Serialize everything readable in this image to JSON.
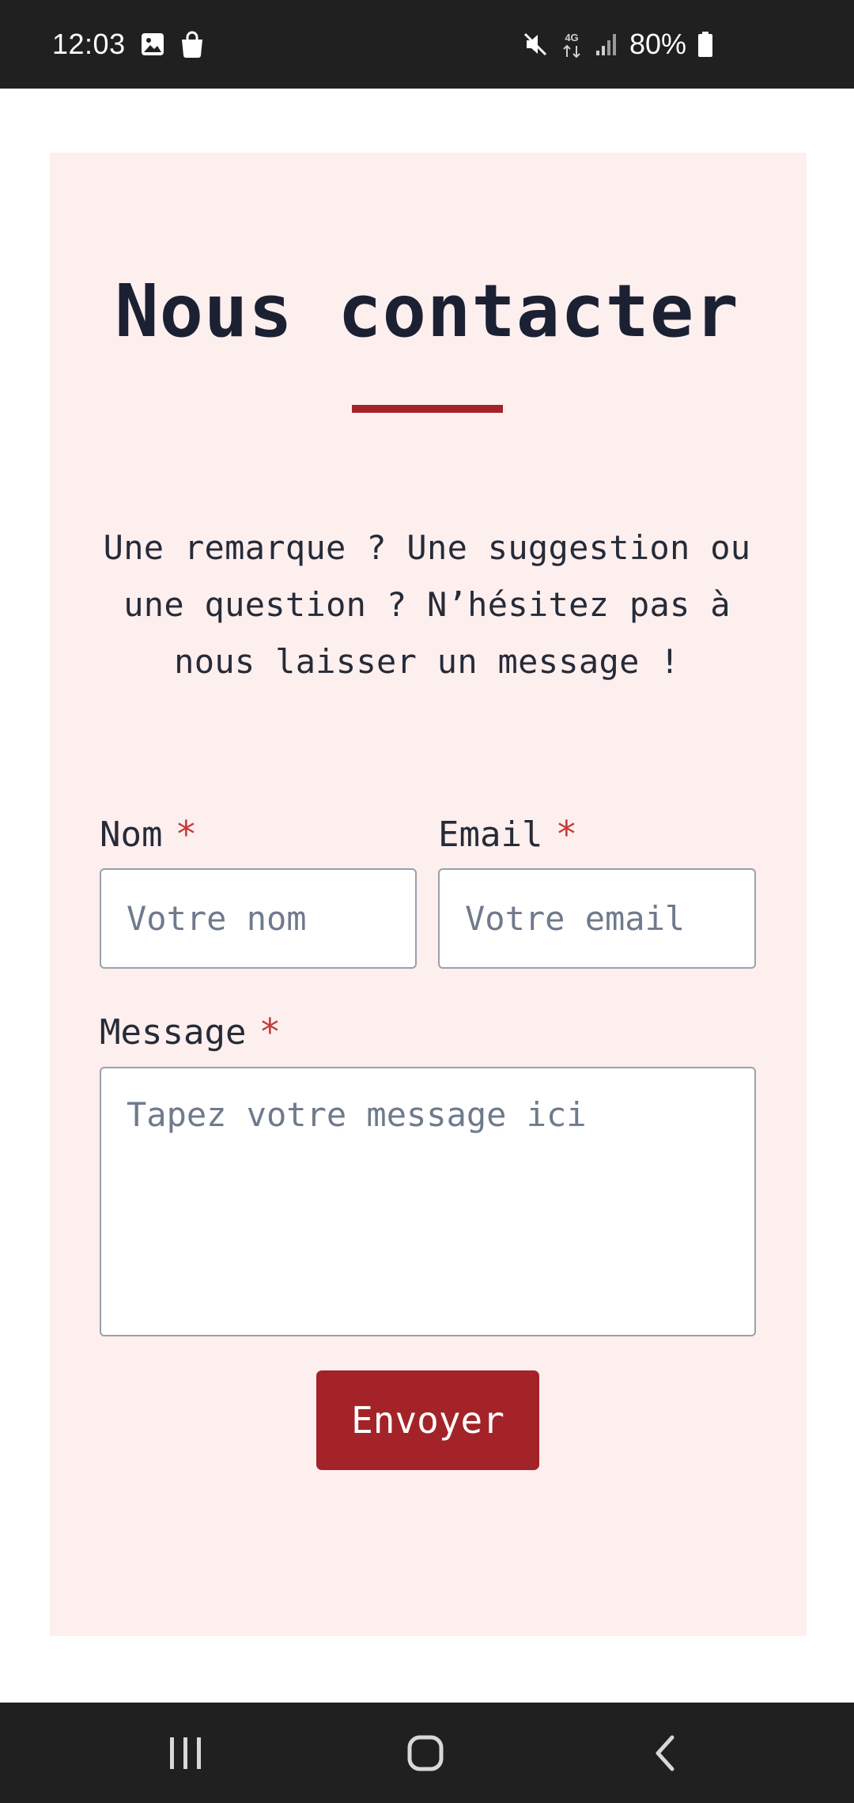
{
  "status_bar": {
    "time": "12:03",
    "left_icons": [
      "image-icon",
      "shopping-bag-icon"
    ],
    "right_icons": [
      "mute-icon",
      "4g-data-icon",
      "signal-icon"
    ],
    "battery": "80%",
    "network_type": "4G"
  },
  "contact": {
    "title": "Nous contacter",
    "intro": "Une remarque ? Une suggestion ou une question ? N’hésitez pas à nous laisser un message !",
    "name_label": "Nom",
    "name_placeholder": "Votre nom",
    "email_label": "Email",
    "email_placeholder": "Votre email",
    "message_label": "Message",
    "message_placeholder": "Tapez votre message ici",
    "required_mark": "*",
    "submit_label": "Envoyer"
  },
  "nav_bar": {
    "buttons": [
      "recent-apps-icon",
      "home-icon",
      "back-icon"
    ]
  },
  "colors": {
    "accent": "#a32329",
    "card_background": "#fdefee",
    "required": "#c33c3c",
    "system_bar": "#202020"
  }
}
